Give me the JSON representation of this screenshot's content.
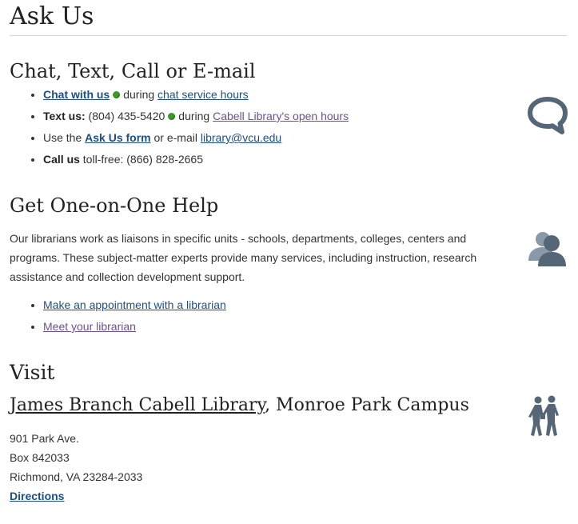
{
  "page": {
    "title": "Ask Us"
  },
  "chat_section": {
    "heading": "Chat, Text, Call or E-mail",
    "chat": {
      "link": "Chat with us",
      "mid": "during",
      "hours_link": "chat service hours"
    },
    "text": {
      "label": "Text us:",
      "number": "(804) 435-5420",
      "mid": "during",
      "hours_link": "Cabell Library's open hours"
    },
    "form": {
      "prefix": "Use the",
      "link": "Ask Us form",
      "mid": "or e-mail",
      "email": "library@vcu.edu"
    },
    "call": {
      "label": "Call us",
      "text": "toll-free: (866) 828-2665"
    },
    "status_color": "#3a9a27",
    "icon": "chat-bubble-icon"
  },
  "help_section": {
    "heading": "Get One-on-One Help",
    "paragraph": "Our librarians work as liaisons in specific units - schools, departments, colleges, centers and programs. These subject-matter experts provide many services, including instruction, research assistance and collection development support.",
    "links": [
      "Make an appointment with a librarian",
      "Meet your librarian"
    ],
    "icon": "people-icon"
  },
  "visit_section": {
    "heading": "Visit",
    "library_link": "James Branch Cabell Library",
    "campus": ", Monroe Park Campus",
    "address": [
      "901 Park Ave.",
      "Box 842033",
      "Richmond, VA 23284-2033"
    ],
    "directions": "Directions",
    "icon": "pedestrians-icon"
  },
  "colors": {
    "link": "#1c4e8a",
    "visited_link": "#6f4f95",
    "icon": "#556677"
  }
}
